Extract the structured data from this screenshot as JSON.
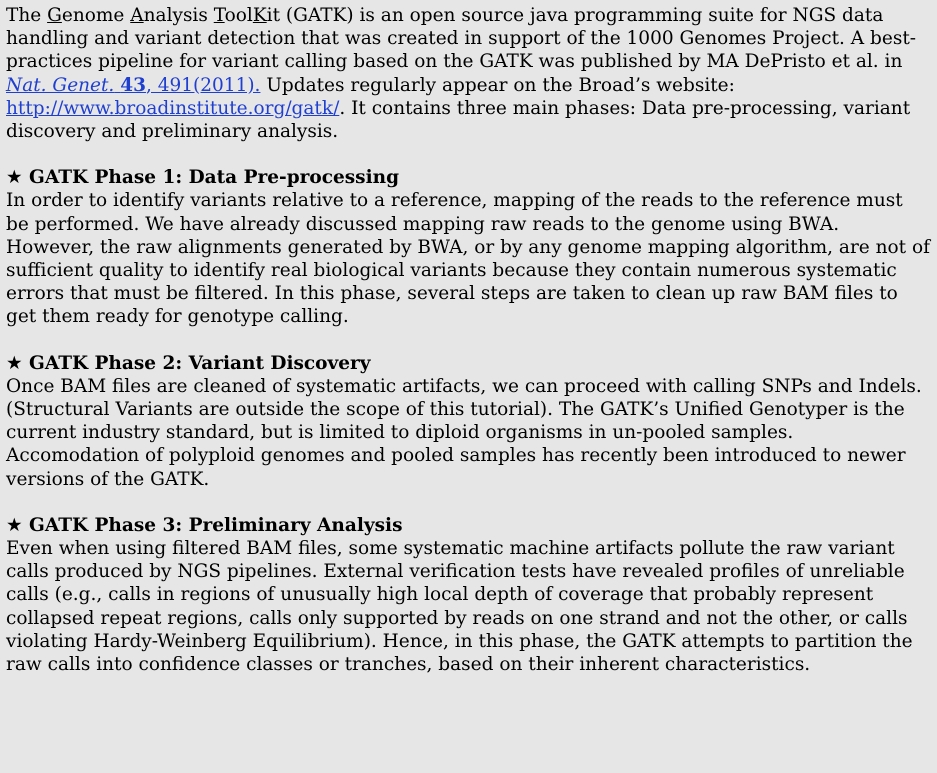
{
  "intro": {
    "pre": "The ",
    "g": "G",
    "g_rest": "enome ",
    "a": "A",
    "a_rest": "nalysis ",
    "t": "T",
    "t_rest": "ool",
    "k": "K",
    "k_rest": "it (GATK) is an open source java programming suite for NGS data handling and variant detection that was created in support of the 1000 Genomes Project.  A best-practices pipeline for variant calling based on the GATK was published by MA DePristo et al. in ",
    "citation_journal": "Nat. Genet.",
    "citation_volume": "43",
    "citation_pages": ", 491(2011).",
    "mid": " Updates regularly appear on the Broad’s website: ",
    "url": "http://www.broadinstitute.org/gatk/",
    "post": ". It contains three main phases: Data pre-processing, variant discovery and preliminary analysis."
  },
  "phases": [
    {
      "star": "★",
      "title": "GATK Phase 1: Data Pre-processing",
      "body": "In order to identify variants relative to a reference, mapping of the reads to the reference must be performed.  We have already discussed mapping raw reads to the genome using BWA.  However, the raw alignments generated by BWA, or by any genome mapping algorithm, are not of sufficient quality to identify real biological variants because they contain numerous systematic errors that must be filtered. In this phase, several steps are taken to clean up raw BAM files to get them ready for genotype calling."
    },
    {
      "star": "★",
      "title": "GATK Phase 2:  Variant Discovery",
      "body": "Once BAM files are cleaned of systematic artifacts, we can proceed with calling SNPs and Indels. (Structural Variants are outside the scope of this tutorial).  The GATK’s Unified Genotyper is the current industry standard, but is limited to diploid organisms in un-pooled samples. Accomodation of polyploid genomes and pooled samples has recently been introduced to newer versions of the GATK."
    },
    {
      "star": "★",
      "title": "GATK Phase 3:  Preliminary Analysis",
      "body": "Even when using filtered BAM files, some systematic machine artifacts pollute the raw variant calls produced by NGS pipelines.  External verification tests have revealed profiles of unreliable calls (e.g., calls in regions of unusually high local depth of coverage that probably represent collapsed repeat regions, calls only supported by reads on one strand and not the other, or calls violating Hardy-Weinberg Equilibrium).  Hence, in this phase, the GATK attempts to partition the raw calls into confidence classes or tranches, based on their inherent characteristics."
    }
  ]
}
